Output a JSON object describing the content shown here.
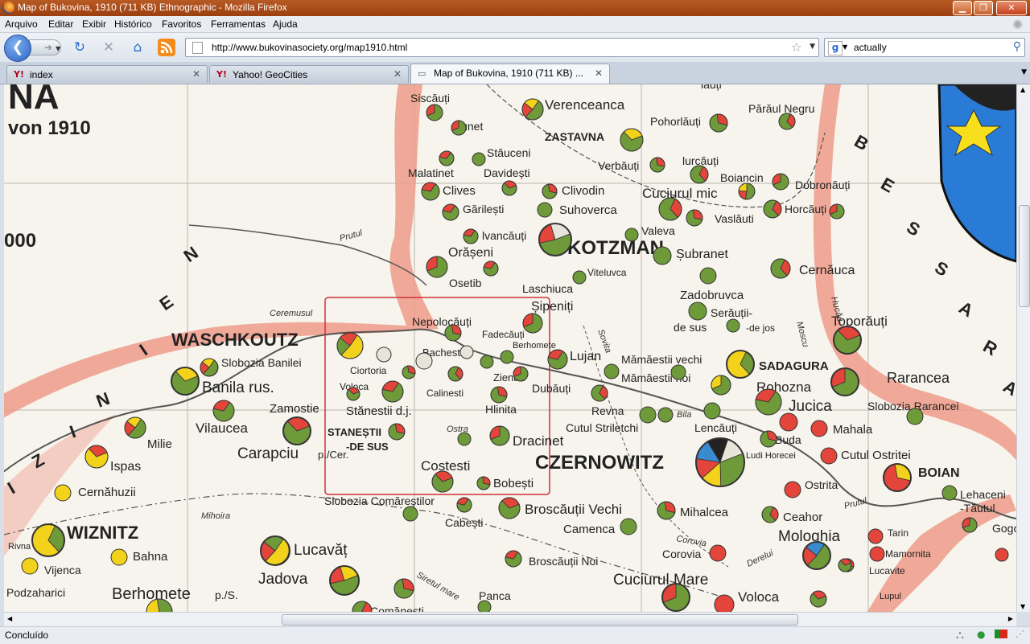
{
  "window": {
    "title": "Map of Bukovina, 1910 (711 KB) Ethnographic - Mozilla Firefox"
  },
  "menu": [
    "Arquivo",
    "Editar",
    "Exibir",
    "Histórico",
    "Favoritos",
    "Ferramentas",
    "Ajuda"
  ],
  "nav": {
    "url": "http://www.bukovinasociety.org/map1910.html",
    "search_value": "actually",
    "search_engine_letter": "g"
  },
  "tabs": [
    {
      "label": "index",
      "active": false
    },
    {
      "label": "Yahoo! GeoCities",
      "active": false
    },
    {
      "label": "Map of Bukovina, 1910 (711 KB) ...",
      "active": true
    }
  ],
  "status": {
    "text": "Concluído"
  },
  "map": {
    "header": {
      "big": "NA",
      "year": "von 1910"
    },
    "edge_fragments": {
      "scale": "000"
    },
    "region_letters_left": [
      "N",
      "E",
      "I",
      "N",
      "I",
      "Z",
      "I"
    ],
    "region_letters_right": [
      "B",
      "E",
      "S",
      "S",
      "A",
      "R",
      "A"
    ],
    "rivers": {
      "ceremusul": "Ceremusul",
      "prutul_top": "Prutul",
      "prutul_bottom": "Prutul",
      "siretul_mare": "Siretul mare",
      "mihoira": "Mihoira",
      "sovita": "Sovita",
      "corovia": "Corovia",
      "derelui": "Derelui",
      "bila": "Bila",
      "hucau": "Hucău",
      "moscu": "Moscu",
      "ostra": "Ostra"
    },
    "cities": {
      "waschkoutz": "WASCHKOUTZ",
      "kotzman": "KOTZMAN",
      "czernowitz": "CZERNOWITZ",
      "wiznitz": "WIZNITZ",
      "sadagura": "SADAGURA",
      "boian": "BOIAN",
      "zastavna": "ZASTAVNA",
      "stanestii_de_sus": "STANEȘTII",
      "de_sus": "-DE SUS"
    },
    "places": {
      "siscauti": "Siscăuți",
      "verenceanca": "Verenceanca",
      "piranul_negru": "Părăul Negru",
      "pohorlauti": "Pohorlăuți",
      "iunet": "lunet",
      "stauceni": "Stăuceni",
      "davidesti": "Davidești",
      "malatinet": "Malatinet",
      "verbauti": "Verbăuți",
      "iurcauti": "lurcăuți",
      "boiancin": "Boiancin",
      "dobronauti": "Dobronăuți",
      "clives": "Clives",
      "clivodin": "Clivodin",
      "cuciurul_mic": "Cuciurul mic",
      "garilesti": "Gărilești",
      "suhoverca": "Suhoverca",
      "vaslauti": "Vaslăuti",
      "horcauti": "Horcăuți",
      "ivancauti": "lvancăuți",
      "valeva": "Valeva",
      "oraseni": "Orășeni",
      "sibranet": "Șubranet",
      "viteluvca": "Viteluvca",
      "cernauca": "Cernăuca",
      "osetib": "Osetib",
      "laschiuca": "Laschiuca",
      "sipeniti": "Șipeniți",
      "zadobruvca": "Zadobruvca",
      "serautii_de_sus": "Serăuții-",
      "de_sus_sm": "de sus",
      "de_jos": "-de jos",
      "toporauti": "Toporăuți",
      "nepolocauti": "Nepolocăuți",
      "fadecauti": "Fadecăuți",
      "bachesti": "Bachesti",
      "berhomete": "Berhomete",
      "rarancea": "Rarancea",
      "lujan": "Lujan",
      "mamaestii_vechi": "Mămăestii vechi",
      "mamaestii_noi": "Mămăestii noi",
      "slobozia_banilei": "Slobozia Banilei",
      "ciortoria": "Ciortoria",
      "zienau": "Zienău",
      "rohozna": "Rohozna",
      "banilarus": "Banila rus.",
      "voloca": "Voloca",
      "calinesti": "Calinesti",
      "dubauti": "Dubăuți",
      "jucica": "Jucica",
      "slobozia_rarancei": "Slobozia Rarancei",
      "zamostie": "Zamostie",
      "stanestii_dj": "Stănestii d.j.",
      "hlinita": "Hlinita",
      "revna": "Revna",
      "lencauti": "Lencăuți",
      "mahala": "Mahala",
      "vilaucea": "Vilaucea",
      "cutul_striletchi": "Cutul Striletchi",
      "buda": "Buda",
      "milie": "Milie",
      "carapciu": "Carapciu",
      "p_cer": "p./Cer.",
      "dracinet": "Dracinet",
      "ludi_horecei": "Ludi Horecei",
      "cutul_ostritei": "Cutul Ostritei",
      "ispas": "Ispas",
      "costesti": "Costesti",
      "bobesti": "Bobești",
      "ostrita": "Ostrita",
      "lehaceni": "Lehaceni",
      "tautul": "-Tăutul",
      "cernahuzii": "Cernăhuzii",
      "slobozia_comarestilor": "Slobozia Comăreștilor",
      "broscautii_vechi": "Broscăuții Vechi",
      "mihalcea": "Mihalcea",
      "ceahor": "Ceahor",
      "gogo": "Gogo",
      "rivna": "Rivna",
      "cabesti": "Cabești",
      "camenca": "Camenca",
      "mologhia": "Mologhia",
      "tarin": "Tarin",
      "mamornita": "Mamornita",
      "bahna": "Bahna",
      "lucavat": "Lucavăț",
      "corovia": "Corovia",
      "lucavite": "Lucavite",
      "vijenca": "Vijenca",
      "jadova": "Jadova",
      "broscautii_noi": "Broscăuții Noi",
      "podzaharici": "Podzaharici",
      "berhomete_ps": "Berhomete",
      "p_s": "p./S.",
      "panca": "Panca",
      "cuciurul_mare": "Cuciurul Mare",
      "voloca2": "Voloca",
      "comanesti": "Comănești",
      "lupul": "Lupul",
      "iauti": "lauți"
    },
    "colors": {
      "paper": "#f6f4ec",
      "border_band": "#ef9b8a",
      "red": "#e4453a",
      "green": "#6e9a3a",
      "yellow": "#f2d21b",
      "river": "#555555",
      "highlight": "#d0303a",
      "shield_blue": "#2a7bd6",
      "star_yellow": "#f7df1e"
    }
  }
}
